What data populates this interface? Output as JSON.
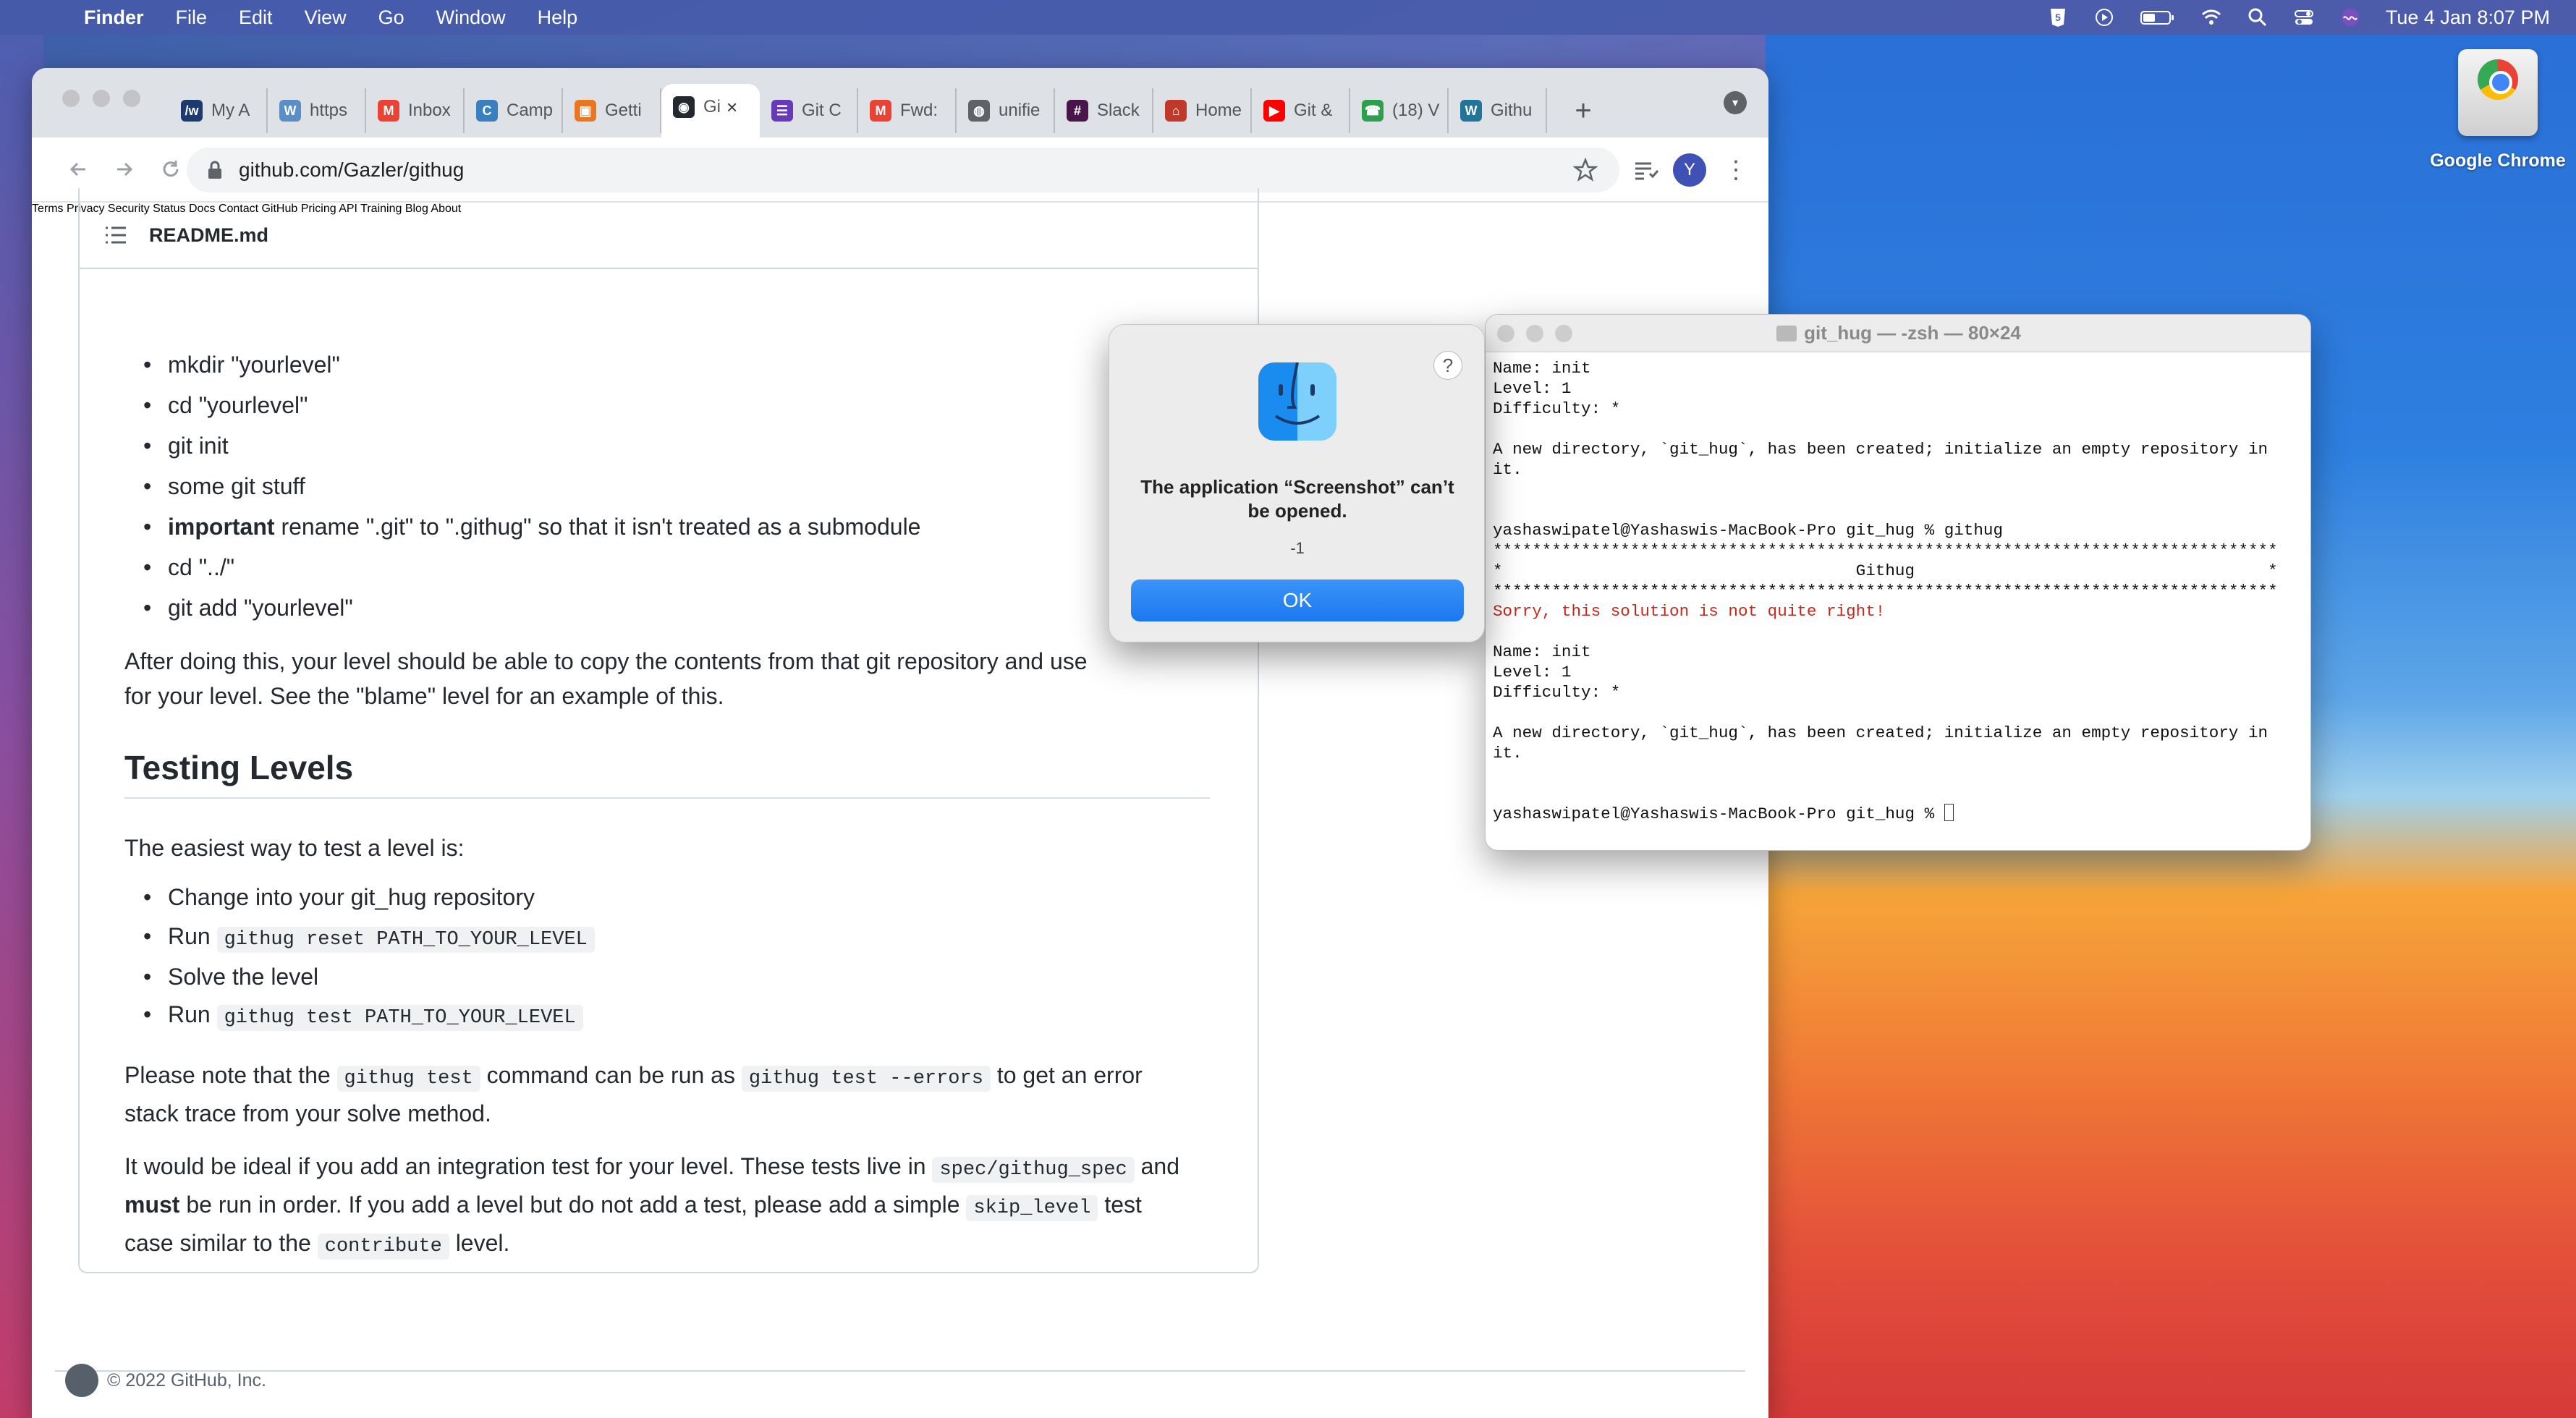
{
  "menubar": {
    "app": "Finder",
    "items": [
      "File",
      "Edit",
      "View",
      "Go",
      "Window",
      "Help"
    ],
    "clock": "Tue 4 Jan  8:07 PM"
  },
  "desktop": {
    "chrome_label": "Google Chrome"
  },
  "browser": {
    "tabs": [
      {
        "label": "My A",
        "icon": "aw-icon",
        "color": "#1c3a6e",
        "glyph": "/w"
      },
      {
        "label": "https",
        "icon": "w-icon",
        "color": "#5a8ec7",
        "glyph": "W"
      },
      {
        "label": "Inbox",
        "icon": "gmail-icon",
        "color": "#ea4335",
        "glyph": "M"
      },
      {
        "label": "Camp",
        "icon": "c-icon",
        "color": "#3a7fc0",
        "glyph": "C"
      },
      {
        "label": "Getti",
        "icon": "course-icon",
        "color": "#e87722",
        "glyph": "▣"
      },
      {
        "label": "Gi",
        "icon": "github-icon",
        "color": "#24292f",
        "glyph": "◉",
        "active": true
      },
      {
        "label": "Git C",
        "icon": "form-icon",
        "color": "#673ab7",
        "glyph": "☰"
      },
      {
        "label": "Fwd:",
        "icon": "gmail-icon",
        "color": "#ea4335",
        "glyph": "M"
      },
      {
        "label": "unifie",
        "icon": "globe-icon",
        "color": "#5f6368",
        "glyph": "◍"
      },
      {
        "label": "Slack",
        "icon": "slack-icon",
        "color": "#4a154b",
        "glyph": "#"
      },
      {
        "label": "Home",
        "icon": "home-icon",
        "color": "#c0392b",
        "glyph": "⌂"
      },
      {
        "label": "Git &",
        "icon": "youtube-icon",
        "color": "#ff0000",
        "glyph": "▶"
      },
      {
        "label": "(18) V",
        "icon": "chat-icon",
        "color": "#2e9e4f",
        "glyph": "☎"
      },
      {
        "label": "Githu",
        "icon": "wordpress-icon",
        "color": "#21759b",
        "glyph": "W"
      }
    ],
    "new_tab": "+",
    "url": "github.com/Gazler/githug",
    "profile_initial": "Y"
  },
  "readme": {
    "filename": "README.md",
    "steps": [
      {
        "text": "mkdir \"yourlevel\""
      },
      {
        "text": "cd \"yourlevel\""
      },
      {
        "text": "git init"
      },
      {
        "text": "some git stuff"
      },
      {
        "bold": "important",
        "text": " rename \".git\" to \".githug\" so that it isn't treated as a submodule"
      },
      {
        "text": "cd \"../\""
      },
      {
        "text": "git add \"yourlevel\""
      }
    ],
    "after_para_1": "After doing this, your level should be able to copy the contents from that git repository and use",
    "after_para_2": "for your level. See the \"blame\" level for an example of this.",
    "testing_heading": "Testing Levels",
    "testing_intro": "The easiest way to test a level is:",
    "testing_steps": {
      "s1": "Change into your git_hug repository",
      "s2_prefix": "Run ",
      "s2_code": "githug reset PATH_TO_YOUR_LEVEL",
      "s3": "Solve the level",
      "s4_prefix": "Run ",
      "s4_code": "githug test PATH_TO_YOUR_LEVEL"
    },
    "note": {
      "a": "Please note that the ",
      "code1": "githug test",
      "b": " command can be run as ",
      "code2": "githug test --errors",
      "c": " to get an error",
      "d": "stack trace from your solve method."
    },
    "ideal": {
      "a": "It would be ideal if you add an integration test for your level. These tests live in ",
      "code1": "spec/githug_spec",
      "b": " and",
      "bold": "must",
      "c": " be run in order. If you add a level but do not add a test, please add a simple ",
      "code2": "skip_level",
      "d": " test",
      "e": "case similar to the ",
      "code3": "contribute",
      "f": " level."
    }
  },
  "footer": {
    "copyright": "© 2022 GitHub, Inc.",
    "links": [
      "Terms",
      "Privacy",
      "Security",
      "Status",
      "Docs",
      "Contact GitHub",
      "Pricing",
      "API",
      "Training",
      "Blog",
      "About"
    ]
  },
  "alert": {
    "title": "The application “Screenshot” can’t be opened.",
    "code": "-1",
    "ok": "OK",
    "help": "?"
  },
  "terminal": {
    "title": "git_hug — -zsh — 80×24",
    "lines": [
      {
        "t": "Name: init"
      },
      {
        "t": "Level: 1"
      },
      {
        "t": "Difficulty: *"
      },
      {
        "t": ""
      },
      {
        "t": "A new directory, `git_hug`, has been created; initialize an empty repository in"
      },
      {
        "t": "it."
      },
      {
        "t": ""
      },
      {
        "t": ""
      },
      {
        "t": "yashaswipatel@Yashaswis-MacBook-Pro git_hug % githug"
      },
      {
        "t": "********************************************************************************"
      },
      {
        "t": "*                                    Githug                                    *"
      },
      {
        "t": "********************************************************************************"
      },
      {
        "t": "Sorry, this solution is not quite right!",
        "red": true
      },
      {
        "t": ""
      },
      {
        "t": "Name: init"
      },
      {
        "t": "Level: 1"
      },
      {
        "t": "Difficulty: *"
      },
      {
        "t": ""
      },
      {
        "t": "A new directory, `git_hug`, has been created; initialize an empty repository in"
      },
      {
        "t": "it."
      },
      {
        "t": ""
      },
      {
        "t": ""
      },
      {
        "t": "yashaswipatel@Yashaswis-MacBook-Pro git_hug % ",
        "cursor": true
      }
    ]
  }
}
